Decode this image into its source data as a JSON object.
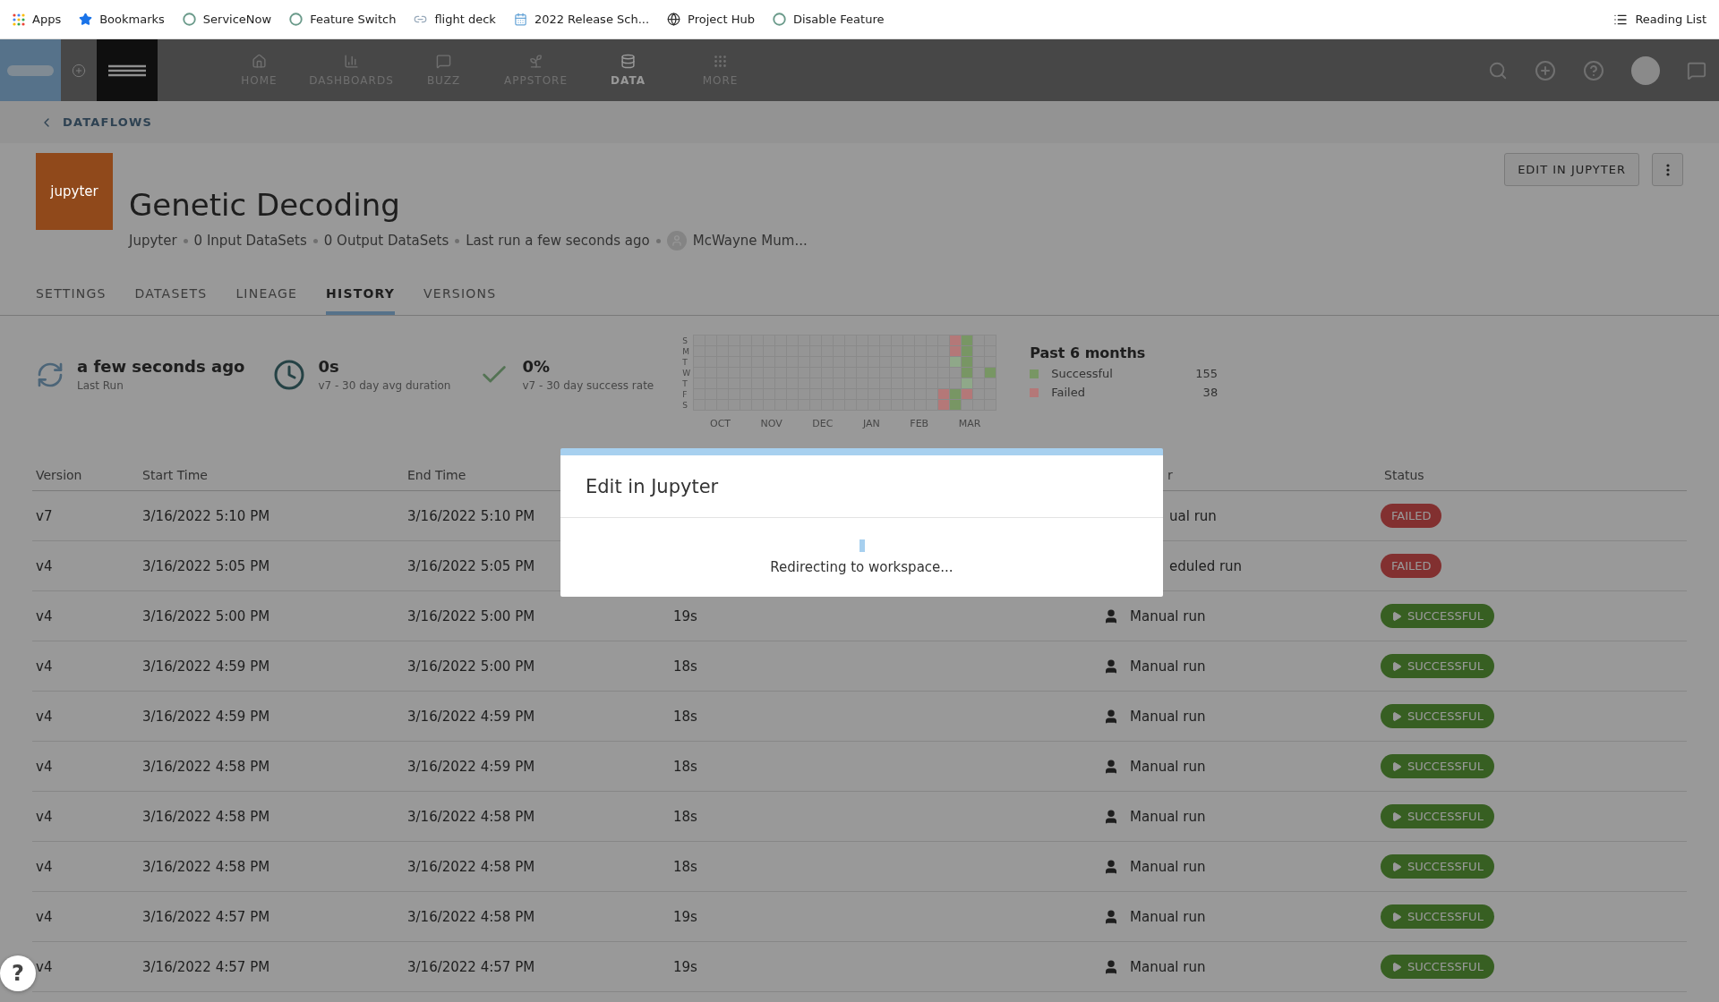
{
  "bookmarks_bar": {
    "items": [
      {
        "label": "Apps"
      },
      {
        "label": "Bookmarks"
      },
      {
        "label": "ServiceNow"
      },
      {
        "label": "Feature Switch"
      },
      {
        "label": "flight deck"
      },
      {
        "label": "2022 Release Sch..."
      },
      {
        "label": "Project Hub"
      },
      {
        "label": "Disable Feature"
      }
    ],
    "reading_list": "Reading List"
  },
  "nav": {
    "items": [
      {
        "label": "HOME",
        "selected": false
      },
      {
        "label": "DASHBOARDS",
        "selected": false
      },
      {
        "label": "BUZZ",
        "selected": false
      },
      {
        "label": "APPSTORE",
        "selected": false
      },
      {
        "label": "DATA",
        "selected": true
      },
      {
        "label": "MORE",
        "selected": false
      }
    ]
  },
  "breadcrumb": "DATAFLOWS",
  "header": {
    "logo_text": "jupyter",
    "title": "Genetic Decoding",
    "meta": [
      "Jupyter",
      "0 Input DataSets",
      "0 Output DataSets",
      "Last run a few seconds ago"
    ],
    "owner": "McWayne Mum...",
    "button": "EDIT IN JUPYTER"
  },
  "tabs": [
    {
      "label": "SETTINGS",
      "selected": false
    },
    {
      "label": "DATASETS",
      "selected": false
    },
    {
      "label": "LINEAGE",
      "selected": false
    },
    {
      "label": "HISTORY",
      "selected": true
    },
    {
      "label": "VERSIONS",
      "selected": false
    }
  ],
  "stats": [
    {
      "kind": "sync",
      "value": "a few seconds ago",
      "label": "Last Run"
    },
    {
      "kind": "clock",
      "value": "0s",
      "label": "v7 - 30 day avg duration"
    },
    {
      "kind": "check",
      "value": "0%",
      "label": "v7 - 30 day success rate"
    }
  ],
  "heatmap": {
    "months": [
      "OCT",
      "NOV",
      "DEC",
      "JAN",
      "FEB",
      "MAR"
    ],
    "rows": [
      {
        "day": "S",
        "cells": [
          {
            "color": "#959595"
          },
          {
            "color": "#959595"
          },
          {
            "color": "#959595"
          },
          {
            "color": "#959595"
          },
          {
            "color": "#959595"
          },
          {
            "color": "#959595"
          },
          {
            "color": "#959595"
          },
          {
            "color": "#959595"
          },
          {
            "color": "#959595"
          },
          {
            "color": "#959595"
          },
          {
            "color": "#959595"
          },
          {
            "color": "#959595"
          },
          {
            "color": "#959595"
          },
          {
            "color": "#959595"
          },
          {
            "color": "#959595"
          },
          {
            "color": "#959595"
          },
          {
            "color": "#959595"
          },
          {
            "color": "#959595"
          },
          {
            "color": "#959595"
          },
          {
            "color": "#959595"
          },
          {
            "color": "#959595"
          },
          {
            "color": "#959595"
          },
          {
            "color": "#b47878"
          },
          {
            "color": "#789664"
          },
          {
            "color": "#959595"
          },
          {
            "color": "#959595"
          }
        ]
      },
      {
        "day": "M",
        "cells": [
          {
            "color": "#959595"
          },
          {
            "color": "#959595"
          },
          {
            "color": "#959595"
          },
          {
            "color": "#959595"
          },
          {
            "color": "#959595"
          },
          {
            "color": "#959595"
          },
          {
            "color": "#959595"
          },
          {
            "color": "#959595"
          },
          {
            "color": "#959595"
          },
          {
            "color": "#959595"
          },
          {
            "color": "#959595"
          },
          {
            "color": "#959595"
          },
          {
            "color": "#959595"
          },
          {
            "color": "#959595"
          },
          {
            "color": "#959595"
          },
          {
            "color": "#959595"
          },
          {
            "color": "#959595"
          },
          {
            "color": "#959595"
          },
          {
            "color": "#959595"
          },
          {
            "color": "#959595"
          },
          {
            "color": "#959595"
          },
          {
            "color": "#959595"
          },
          {
            "color": "#b47878"
          },
          {
            "color": "#789664"
          },
          {
            "color": "#959595"
          },
          {
            "color": "#959595"
          }
        ]
      },
      {
        "day": "T",
        "cells": [
          {
            "color": "#959595"
          },
          {
            "color": "#959595"
          },
          {
            "color": "#959595"
          },
          {
            "color": "#959595"
          },
          {
            "color": "#959595"
          },
          {
            "color": "#959595"
          },
          {
            "color": "#959595"
          },
          {
            "color": "#959595"
          },
          {
            "color": "#959595"
          },
          {
            "color": "#959595"
          },
          {
            "color": "#959595"
          },
          {
            "color": "#959595"
          },
          {
            "color": "#959595"
          },
          {
            "color": "#959595"
          },
          {
            "color": "#959595"
          },
          {
            "color": "#959595"
          },
          {
            "color": "#959595"
          },
          {
            "color": "#959595"
          },
          {
            "color": "#959595"
          },
          {
            "color": "#959595"
          },
          {
            "color": "#959595"
          },
          {
            "color": "#959595"
          },
          {
            "color": "#8fa889"
          },
          {
            "color": "#789664"
          },
          {
            "color": "#959595"
          },
          {
            "color": "#959595"
          }
        ]
      },
      {
        "day": "W",
        "cells": [
          {
            "color": "#959595"
          },
          {
            "color": "#959595"
          },
          {
            "color": "#959595"
          },
          {
            "color": "#959595"
          },
          {
            "color": "#959595"
          },
          {
            "color": "#959595"
          },
          {
            "color": "#959595"
          },
          {
            "color": "#959595"
          },
          {
            "color": "#959595"
          },
          {
            "color": "#959595"
          },
          {
            "color": "#959595"
          },
          {
            "color": "#959595"
          },
          {
            "color": "#959595"
          },
          {
            "color": "#959595"
          },
          {
            "color": "#959595"
          },
          {
            "color": "#959595"
          },
          {
            "color": "#959595"
          },
          {
            "color": "#959595"
          },
          {
            "color": "#959595"
          },
          {
            "color": "#959595"
          },
          {
            "color": "#959595"
          },
          {
            "color": "#959595"
          },
          {
            "color": "#959595"
          },
          {
            "color": "#789664"
          },
          {
            "color": "#959595"
          },
          {
            "color": "#789664"
          }
        ]
      },
      {
        "day": "T",
        "cells": [
          {
            "color": "#959595"
          },
          {
            "color": "#959595"
          },
          {
            "color": "#959595"
          },
          {
            "color": "#959595"
          },
          {
            "color": "#959595"
          },
          {
            "color": "#959595"
          },
          {
            "color": "#959595"
          },
          {
            "color": "#959595"
          },
          {
            "color": "#959595"
          },
          {
            "color": "#959595"
          },
          {
            "color": "#959595"
          },
          {
            "color": "#959595"
          },
          {
            "color": "#959595"
          },
          {
            "color": "#959595"
          },
          {
            "color": "#959595"
          },
          {
            "color": "#959595"
          },
          {
            "color": "#959595"
          },
          {
            "color": "#959595"
          },
          {
            "color": "#959595"
          },
          {
            "color": "#959595"
          },
          {
            "color": "#959595"
          },
          {
            "color": "#959595"
          },
          {
            "color": "#959595"
          },
          {
            "color": "#8fa889"
          },
          {
            "color": "#959595"
          },
          {
            "color": "#959595"
          }
        ]
      },
      {
        "day": "F",
        "cells": [
          {
            "color": "#959595"
          },
          {
            "color": "#959595"
          },
          {
            "color": "#959595"
          },
          {
            "color": "#959595"
          },
          {
            "color": "#959595"
          },
          {
            "color": "#959595"
          },
          {
            "color": "#959595"
          },
          {
            "color": "#959595"
          },
          {
            "color": "#959595"
          },
          {
            "color": "#959595"
          },
          {
            "color": "#959595"
          },
          {
            "color": "#959595"
          },
          {
            "color": "#959595"
          },
          {
            "color": "#959595"
          },
          {
            "color": "#959595"
          },
          {
            "color": "#959595"
          },
          {
            "color": "#959595"
          },
          {
            "color": "#959595"
          },
          {
            "color": "#959595"
          },
          {
            "color": "#959595"
          },
          {
            "color": "#959595"
          },
          {
            "color": "#b47878"
          },
          {
            "color": "#789664"
          },
          {
            "color": "#b47878"
          },
          {
            "color": "#959595"
          },
          {
            "color": "#959595"
          }
        ]
      },
      {
        "day": "S",
        "cells": [
          {
            "color": "#959595"
          },
          {
            "color": "#959595"
          },
          {
            "color": "#959595"
          },
          {
            "color": "#959595"
          },
          {
            "color": "#959595"
          },
          {
            "color": "#959595"
          },
          {
            "color": "#959595"
          },
          {
            "color": "#959595"
          },
          {
            "color": "#959595"
          },
          {
            "color": "#959595"
          },
          {
            "color": "#959595"
          },
          {
            "color": "#959595"
          },
          {
            "color": "#959595"
          },
          {
            "color": "#959595"
          },
          {
            "color": "#959595"
          },
          {
            "color": "#959595"
          },
          {
            "color": "#959595"
          },
          {
            "color": "#959595"
          },
          {
            "color": "#959595"
          },
          {
            "color": "#959595"
          },
          {
            "color": "#959595"
          },
          {
            "color": "#b47878"
          },
          {
            "color": "#789664"
          },
          {
            "color": "#959595"
          },
          {
            "color": "#959595"
          },
          {
            "color": "#959595"
          }
        ]
      }
    ]
  },
  "legend": {
    "title": "Past 6 months",
    "items": [
      {
        "label": "Successful",
        "count": "155",
        "color": "#789664"
      },
      {
        "label": "Failed",
        "count": "38",
        "color": "#b47878"
      }
    ]
  },
  "table": {
    "columns": [
      "Version",
      "Start Time",
      "End Time",
      "r",
      "Status"
    ],
    "rows": [
      {
        "version": "v7",
        "start": "3/16/2022 5:10 PM",
        "end": "3/16/2022 5:10 PM",
        "trigger": "ual run",
        "status": "FAILED",
        "kind": "failed"
      },
      {
        "version": "v4",
        "start": "3/16/2022 5:05 PM",
        "end": "3/16/2022 5:05 PM",
        "trigger": "eduled run",
        "status": "FAILED",
        "kind": "failed"
      },
      {
        "version": "v4",
        "start": "3/16/2022 5:00 PM",
        "end": "3/16/2022 5:00 PM",
        "duration": "19s",
        "trigger": "Manual run",
        "status": "SUCCESSFUL",
        "kind": "successful"
      },
      {
        "version": "v4",
        "start": "3/16/2022 4:59 PM",
        "end": "3/16/2022 5:00 PM",
        "duration": "18s",
        "trigger": "Manual run",
        "status": "SUCCESSFUL",
        "kind": "successful"
      },
      {
        "version": "v4",
        "start": "3/16/2022 4:59 PM",
        "end": "3/16/2022 4:59 PM",
        "duration": "18s",
        "trigger": "Manual run",
        "status": "SUCCESSFUL",
        "kind": "successful"
      },
      {
        "version": "v4",
        "start": "3/16/2022 4:58 PM",
        "end": "3/16/2022 4:59 PM",
        "duration": "18s",
        "trigger": "Manual run",
        "status": "SUCCESSFUL",
        "kind": "successful"
      },
      {
        "version": "v4",
        "start": "3/16/2022 4:58 PM",
        "end": "3/16/2022 4:58 PM",
        "duration": "18s",
        "trigger": "Manual run",
        "status": "SUCCESSFUL",
        "kind": "successful"
      },
      {
        "version": "v4",
        "start": "3/16/2022 4:58 PM",
        "end": "3/16/2022 4:58 PM",
        "duration": "18s",
        "trigger": "Manual run",
        "status": "SUCCESSFUL",
        "kind": "successful"
      },
      {
        "version": "v4",
        "start": "3/16/2022 4:57 PM",
        "end": "3/16/2022 4:58 PM",
        "duration": "19s",
        "trigger": "Manual run",
        "status": "SUCCESSFUL",
        "kind": "successful"
      },
      {
        "version": "v4",
        "start": "3/16/2022 4:57 PM",
        "end": "3/16/2022 4:57 PM",
        "duration": "19s",
        "trigger": "Manual run",
        "status": "SUCCESSFUL",
        "kind": "successful"
      }
    ]
  },
  "modal": {
    "title": "Edit in Jupyter",
    "message": "Redirecting to workspace..."
  },
  "help_button": "?"
}
